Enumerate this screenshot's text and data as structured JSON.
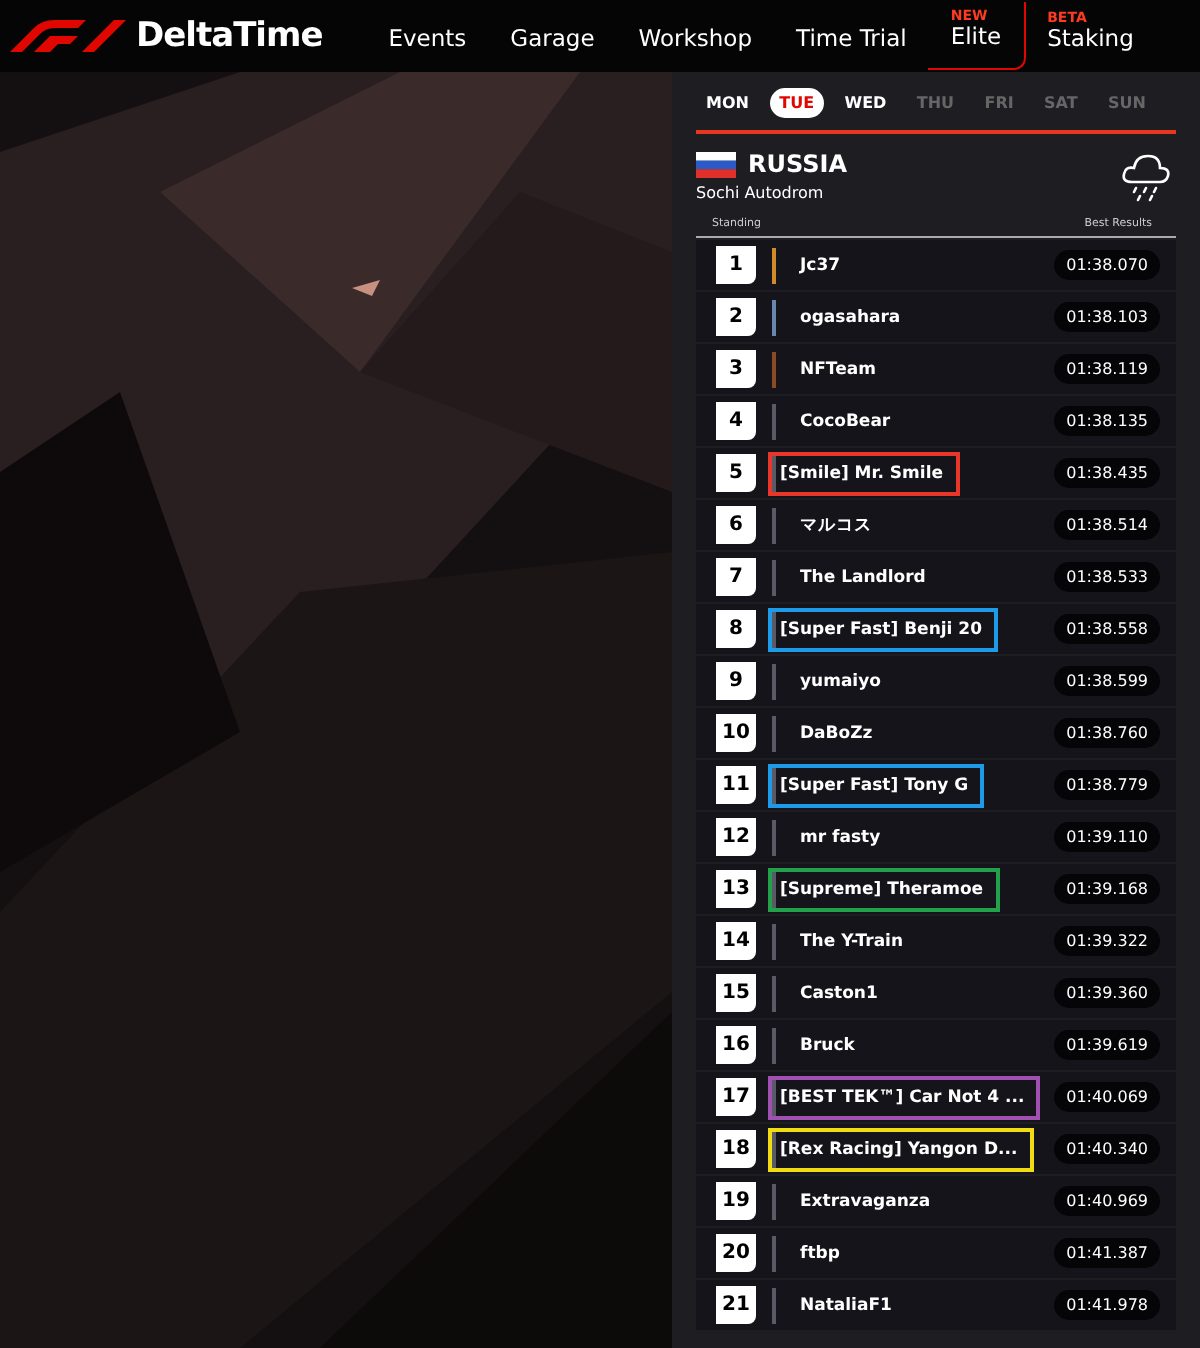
{
  "brand": "DeltaTime",
  "nav": [
    {
      "label": "Events",
      "selected": false
    },
    {
      "label": "Garage",
      "selected": false
    },
    {
      "label": "Workshop",
      "selected": false
    },
    {
      "label": "Time Trial",
      "selected": false
    },
    {
      "label": "Elite",
      "badge": "NEW",
      "selected": true
    },
    {
      "label": "Staking",
      "badge": "BETA",
      "selected": false
    }
  ],
  "days": [
    {
      "label": "MON",
      "selected": false,
      "disabled": false
    },
    {
      "label": "TUE",
      "selected": true,
      "disabled": false
    },
    {
      "label": "WED",
      "selected": false,
      "disabled": false
    },
    {
      "label": "THU",
      "selected": false,
      "disabled": true
    },
    {
      "label": "FRI",
      "selected": false,
      "disabled": true
    },
    {
      "label": "SAT",
      "selected": false,
      "disabled": true
    },
    {
      "label": "SUN",
      "selected": false,
      "disabled": true
    }
  ],
  "event": {
    "country": "RUSSIA",
    "track": "Sochi Autodrom"
  },
  "table": {
    "columns": [
      "Standing",
      "Best Results"
    ],
    "rows": [
      {
        "rank": "1",
        "name": "Jc37",
        "time": "01:38.070",
        "color": "#d08a2a"
      },
      {
        "rank": "2",
        "name": "ogasahara",
        "time": "01:38.103",
        "color": "#6a86aa"
      },
      {
        "rank": "3",
        "name": "NFTeam",
        "time": "01:38.119",
        "color": "#8a4a22"
      },
      {
        "rank": "4",
        "name": "CocoBear",
        "time": "01:38.135",
        "color": "#5a5a66"
      },
      {
        "rank": "5",
        "name": "[Smile] Mr. Smile",
        "time": "01:38.435",
        "color": "#5a5a66",
        "highlight": {
          "color": "#e8372a"
        }
      },
      {
        "rank": "6",
        "name": "マルコス",
        "time": "01:38.514",
        "color": "#5a5a66"
      },
      {
        "rank": "7",
        "name": "The Landlord",
        "time": "01:38.533",
        "color": "#5a5a66"
      },
      {
        "rank": "8",
        "name": "[Super Fast] Benji 20",
        "time": "01:38.558",
        "color": "#5a5a66",
        "highlight": {
          "color": "#1e9be8"
        }
      },
      {
        "rank": "9",
        "name": "yumaiyo",
        "time": "01:38.599",
        "color": "#5a5a66"
      },
      {
        "rank": "10",
        "name": "DaBoZz",
        "time": "01:38.760",
        "color": "#5a5a66"
      },
      {
        "rank": "11",
        "name": "[Super Fast] Tony G",
        "time": "01:38.779",
        "color": "#5a5a66",
        "highlight": {
          "color": "#1e9be8"
        }
      },
      {
        "rank": "12",
        "name": "mr fasty",
        "time": "01:39.110",
        "color": "#5a5a66"
      },
      {
        "rank": "13",
        "name": "[Supreme] Theramoe",
        "time": "01:39.168",
        "color": "#5a5a66",
        "highlight": {
          "color": "#22a04a"
        }
      },
      {
        "rank": "14",
        "name": "The Y-Train",
        "time": "01:39.322",
        "color": "#5a5a66"
      },
      {
        "rank": "15",
        "name": "Caston1",
        "time": "01:39.360",
        "color": "#5a5a66"
      },
      {
        "rank": "16",
        "name": "Bruck",
        "time": "01:39.619",
        "color": "#5a5a66"
      },
      {
        "rank": "17",
        "name": "[BEST TEK™] Car Not 4 ...",
        "time": "01:40.069",
        "color": "#5a5a66",
        "highlight": {
          "color": "#a050b0"
        }
      },
      {
        "rank": "18",
        "name": "[Rex Racing] Yangon D...",
        "time": "01:40.340",
        "color": "#5a5a66",
        "highlight": {
          "color": "#f0dc10"
        }
      },
      {
        "rank": "19",
        "name": "Extravaganza",
        "time": "01:40.969",
        "color": "#5a5a66"
      },
      {
        "rank": "20",
        "name": "ftbp",
        "time": "01:41.387",
        "color": "#5a5a66"
      },
      {
        "rank": "21",
        "name": "NataliaF1",
        "time": "01:41.978",
        "color": "#5a5a66"
      }
    ]
  }
}
